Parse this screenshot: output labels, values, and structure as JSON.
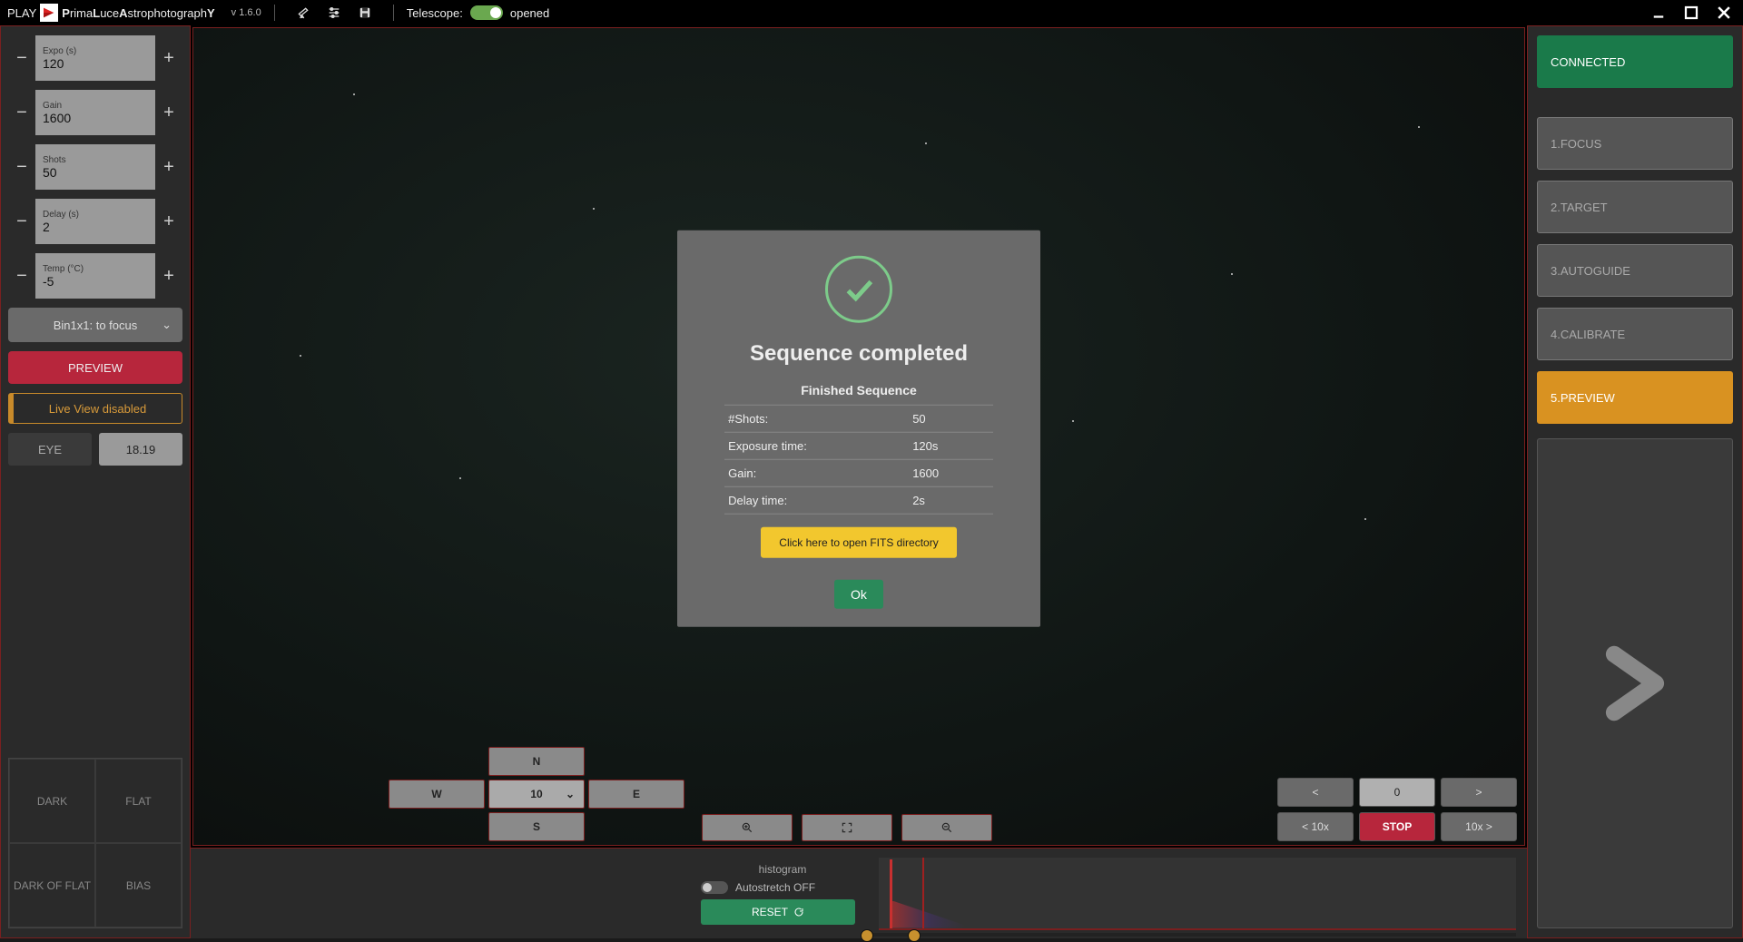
{
  "header": {
    "play": "PLAY",
    "brand": "PrimaLuceAstrophotographY",
    "version": "v 1.6.0",
    "telescope_label": "Telescope:",
    "telescope_state": "opened"
  },
  "left": {
    "steppers": [
      {
        "label": "Expo (s)",
        "value": "120"
      },
      {
        "label": "Gain",
        "value": "1600"
      },
      {
        "label": "Shots",
        "value": "50"
      },
      {
        "label": "Delay (s)",
        "value": "2"
      },
      {
        "label": "Temp (°C)",
        "value": "-5"
      }
    ],
    "binning": "Bin1x1: to focus",
    "preview_btn": "PREVIEW",
    "liveview": "Live View disabled",
    "eye_label": "EYE",
    "eye_value": "18.19",
    "frames": [
      "DARK",
      "FLAT",
      "DARK OF FLAT",
      "BIAS"
    ]
  },
  "nesw": {
    "n": "N",
    "e": "E",
    "s": "S",
    "w": "W",
    "speed": "10"
  },
  "nav": {
    "back": "<",
    "val": "0",
    "fwd": ">",
    "back10": "< 10x",
    "stop": "STOP",
    "fwd10": "10x >"
  },
  "histo": {
    "title": "histogram",
    "auto": "Autostretch OFF",
    "reset": "RESET"
  },
  "right": {
    "connected": "CONNECTED",
    "steps": [
      "1.FOCUS",
      "2.TARGET",
      "3.AUTOGUIDE",
      "4.CALIBRATE",
      "5.PREVIEW"
    ]
  },
  "modal": {
    "title": "Sequence completed",
    "subtitle": "Finished Sequence",
    "rows": [
      {
        "k": "#Shots:",
        "v": "50"
      },
      {
        "k": "Exposure time:",
        "v": "120s"
      },
      {
        "k": "Gain:",
        "v": "1600"
      },
      {
        "k": "Delay time:",
        "v": "2s"
      }
    ],
    "fits": "Click here to open FITS directory",
    "ok": "Ok"
  }
}
